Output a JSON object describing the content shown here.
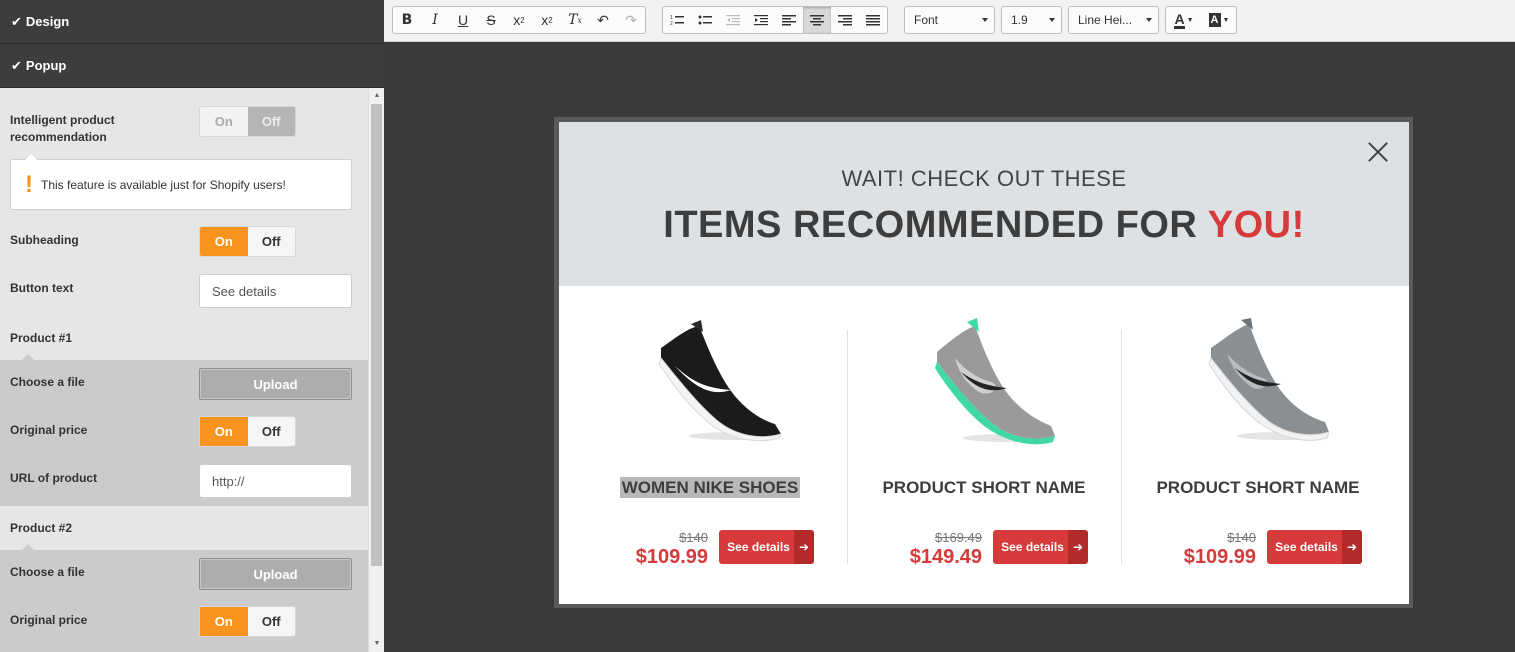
{
  "sidebar": {
    "design_label": "Design",
    "popup_label": "Popup",
    "intelligent_label": "Intelligent product recommendation",
    "intelligent_on": "On",
    "intelligent_off": "Off",
    "notice": "This feature is available just for Shopify users!",
    "subheading_label": "Subheading",
    "toggle_on": "On",
    "toggle_off": "Off",
    "button_text_label": "Button text",
    "button_text_value": "See details",
    "product1_label": "Product #1",
    "product2_label": "Product #2",
    "choose_file_label": "Choose a file",
    "upload_label": "Upload",
    "original_price_label": "Original price",
    "url_label": "URL of product",
    "url_value": "http://"
  },
  "toolbar": {
    "font_select": "Font",
    "size_select": "1.9",
    "line_height_select": "Line Hei..."
  },
  "popup": {
    "subheading": "WAIT! CHECK OUT THESE",
    "heading_main": "ITEMS RECOMMENDED FOR",
    "heading_highlight": "YOU!",
    "products": [
      {
        "name": "WOMEN NIKE SHOES",
        "old_price": "$140",
        "new_price": "$109.99",
        "button": "See details"
      },
      {
        "name": "PRODUCT SHORT NAME",
        "old_price": "$169.49",
        "new_price": "$149.49",
        "button": "See details"
      },
      {
        "name": "PRODUCT SHORT NAME",
        "old_price": "$140",
        "new_price": "$109.99",
        "button": "See details"
      }
    ]
  },
  "colors": {
    "accent_orange": "#f7941d",
    "accent_red": "#d63a3a",
    "sidebar_header": "#3d3d3d",
    "canvas_bg": "#3a3a3a",
    "popup_header_bg": "#dde1e3"
  }
}
